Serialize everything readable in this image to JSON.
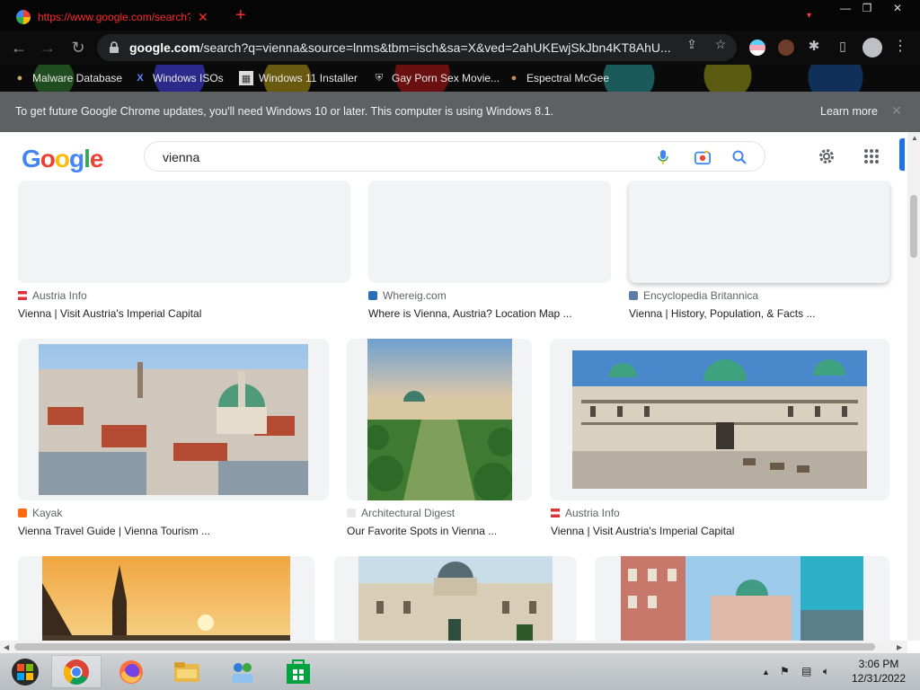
{
  "tab": {
    "title": "https://www.google.com/search?q"
  },
  "omnibox": {
    "domain": "google.com",
    "path": "/search?q=vienna&source=lnms&tbm=isch&sa=X&ved=2ahUKEwjSkJbn4KT8AhU..."
  },
  "bookmarks": [
    {
      "label": "Malware Database",
      "icon": "person-icon"
    },
    {
      "label": "Windows ISOs",
      "icon": "x-logo-icon"
    },
    {
      "label": "Windows 11 Installer",
      "icon": "installer-icon"
    },
    {
      "label": "Gay Porn Sex Movie...",
      "icon": "shield-icon"
    },
    {
      "label": "Espectral McGee",
      "icon": "avatar-icon"
    }
  ],
  "infobar": {
    "message": "To get future Google Chrome updates, you'll need Windows 10 or later. This computer is using Windows 8.1.",
    "learn_more": "Learn more"
  },
  "search": {
    "query": "vienna"
  },
  "results": {
    "row1": [
      {
        "source": "Austria Info",
        "caption": "Vienna | Visit Austria's Imperial Capital"
      },
      {
        "source": "Whereig.com",
        "caption": "Where is Vienna, Austria? Location Map ..."
      },
      {
        "source": "Encyclopedia Britannica",
        "caption": "Vienna | History, Population, & Facts ..."
      }
    ],
    "row2": [
      {
        "source": "Kayak",
        "caption": "Vienna Travel Guide | Vienna Tourism ..."
      },
      {
        "source": "Architectural Digest",
        "caption": "Our Favorite Spots in Vienna ..."
      },
      {
        "source": "Austria Info",
        "caption": "Vienna | Visit Austria's Imperial Capital"
      }
    ]
  },
  "clock": {
    "time": "3:06 PM",
    "date": "12/31/2022"
  },
  "colors": {
    "accent": "#1a73e8",
    "tab_text": "#ff2a2a",
    "infobar": "#5f6064"
  }
}
